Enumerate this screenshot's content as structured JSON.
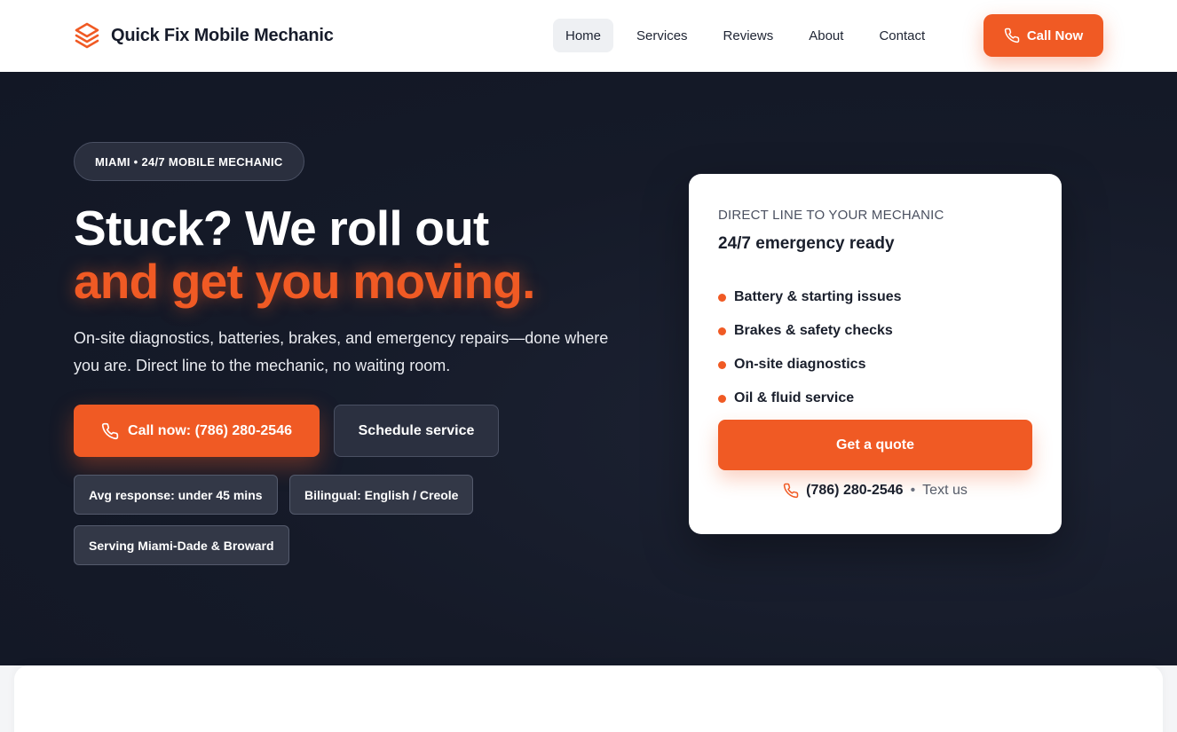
{
  "brand": {
    "name": "Quick Fix Mobile Mechanic",
    "icon": "layers-icon",
    "accent": "#f05a24"
  },
  "nav": {
    "items": [
      {
        "label": "Home",
        "active": true
      },
      {
        "label": "Services"
      },
      {
        "label": "Reviews"
      },
      {
        "label": "About"
      },
      {
        "label": "Contact"
      }
    ],
    "cta_label": "Call Now",
    "cta_icon": "phone-icon"
  },
  "hero": {
    "badge": "MIAMI • 24/7 MOBILE MECHANIC",
    "headline": "Stuck? We roll out",
    "headline_accent": "and get you moving.",
    "subtitle": "On-site diagnostics, batteries, brakes, and emergency repairs—done where you are. Direct line to the mechanic, no waiting room.",
    "primary_cta": "Call now: (786) 280-2546",
    "secondary_cta": "Schedule service",
    "chips": [
      "Avg response: under 45 mins",
      "Bilingual: English / Creole",
      "Serving Miami-Dade & Broward"
    ]
  },
  "card": {
    "eyebrow": "DIRECT LINE TO YOUR MECHANIC",
    "title": "24/7 emergency ready",
    "items": [
      "Battery & starting issues",
      "Brakes & safety checks",
      "On-site diagnostics",
      "Oil & fluid service"
    ],
    "quote_label": "Get a quote",
    "phone": "(786) 280-2546",
    "separator": "•",
    "text_us": "Text us"
  }
}
